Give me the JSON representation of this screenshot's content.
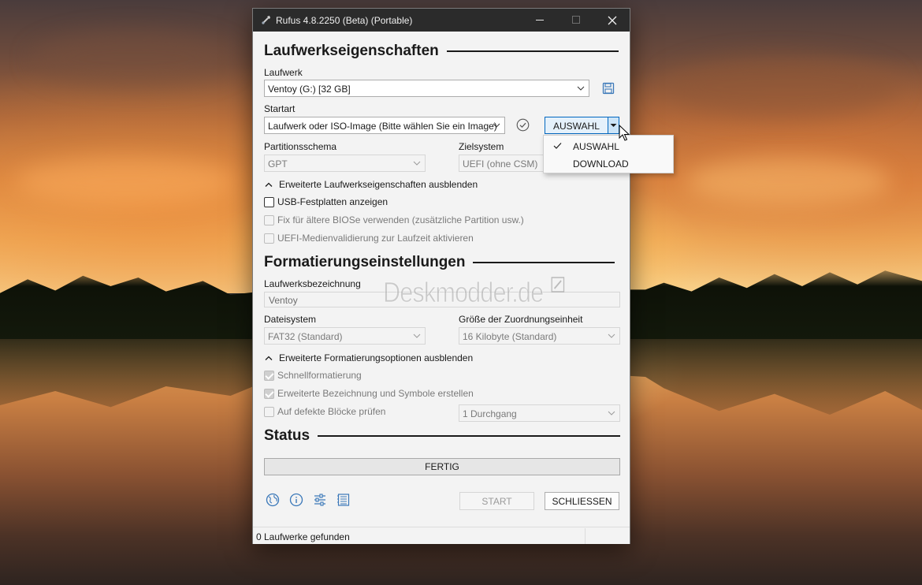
{
  "window": {
    "title": "Rufus 4.8.2250 (Beta) (Portable)"
  },
  "drive_properties": {
    "heading": "Laufwerkseigenschaften",
    "device_label": "Laufwerk",
    "device_value": "Ventoy (G:) [32 GB]",
    "boot_label": "Startart",
    "boot_value": "Laufwerk oder ISO-Image (Bitte wählen Sie ein Image)",
    "select_button": "AUSWAHL",
    "partition_label": "Partitionsschema",
    "partition_value": "GPT",
    "target_label": "Zielsystem",
    "target_value": "UEFI (ohne CSM)",
    "advanced_toggle": "Erweiterte Laufwerkseigenschaften ausblenden",
    "opt_usb_hdd": "USB-Festplatten anzeigen",
    "opt_old_bios": "Fix für ältere BIOSe verwenden (zusätzliche Partition usw.)",
    "opt_uefi_validation": "UEFI-Medienvalidierung zur Laufzeit aktivieren"
  },
  "dropdown_menu": {
    "items": [
      {
        "label": "AUSWAHL",
        "checked": true
      },
      {
        "label": "DOWNLOAD",
        "checked": false
      }
    ]
  },
  "format_options": {
    "heading": "Formatierungseinstellungen",
    "volume_label": "Laufwerksbezeichnung",
    "volume_value": "Ventoy",
    "filesystem_label": "Dateisystem",
    "filesystem_value": "FAT32 (Standard)",
    "cluster_label": "Größe der Zuordnungseinheit",
    "cluster_value": "16 Kilobyte (Standard)",
    "advanced_toggle": "Erweiterte Formatierungsoptionen ausblenden",
    "opt_quick": "Schnellformatierung",
    "opt_extended_label": "Erweiterte Bezeichnung und Symbole erstellen",
    "opt_bad_blocks": "Auf defekte Blöcke prüfen",
    "passes_value": "1 Durchgang"
  },
  "status": {
    "heading": "Status",
    "progress_text": "FERTIG",
    "start_button": "START",
    "close_button": "SCHLIESSEN",
    "statusbar_text": "0 Laufwerke gefunden"
  },
  "watermark": "Deskmodder.de",
  "colors": {
    "accent": "#0067c0",
    "titlebar": "#2b2b2b",
    "window_bg": "#f3f3f3"
  },
  "icons": [
    "rufus-icon",
    "save-icon",
    "check-circle-icon",
    "globe-icon",
    "info-icon",
    "settings-sliders-icon",
    "log-icon"
  ]
}
